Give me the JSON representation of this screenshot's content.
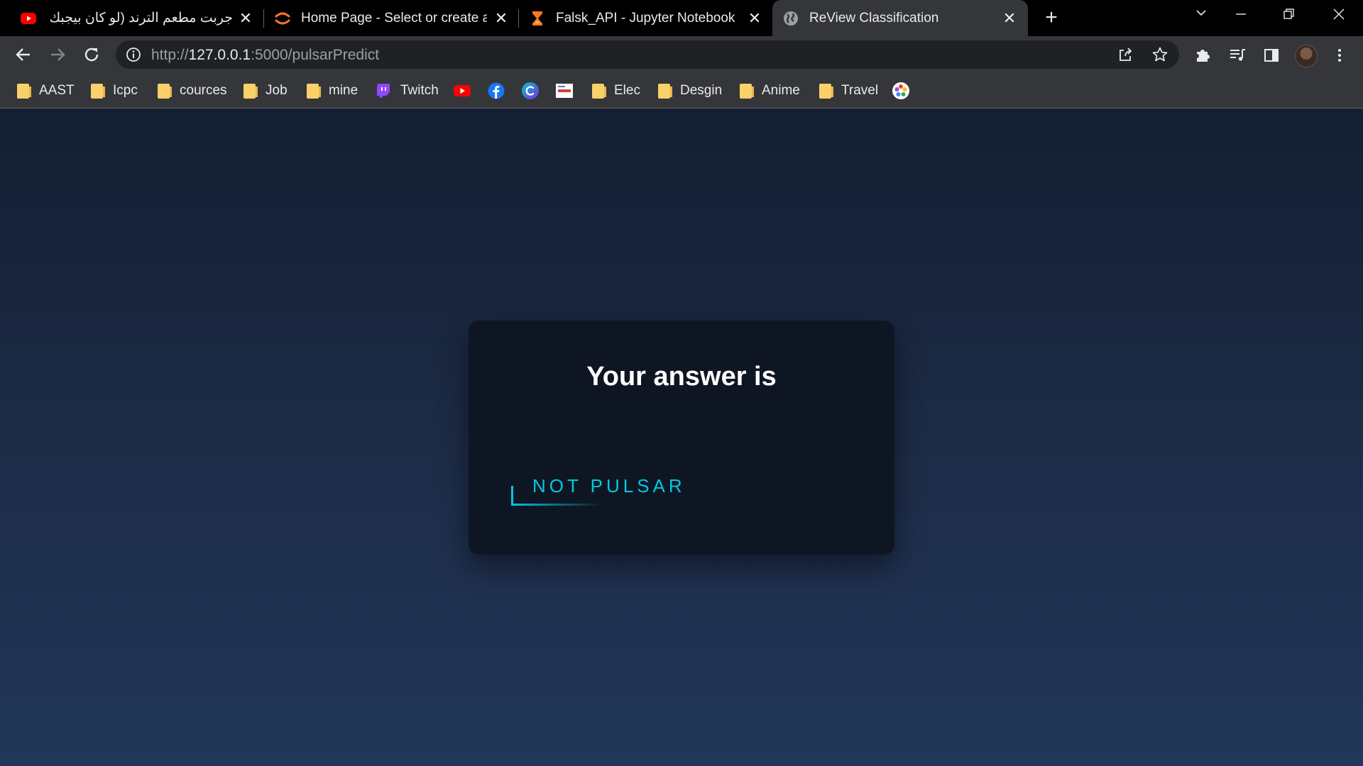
{
  "browser": {
    "tabs": [
      {
        "title": "جربت مطعم الترند (لو كان بيجبك",
        "favicon": "youtube-icon",
        "active": false
      },
      {
        "title": "Home Page - Select or create a n",
        "favicon": "jupyter-icon",
        "active": false
      },
      {
        "title": "Falsk_API - Jupyter Notebook",
        "favicon": "hourglass-icon",
        "active": false
      },
      {
        "title": "ReView Classification",
        "favicon": "globe-icon",
        "active": true
      }
    ],
    "address": {
      "scheme": "http://",
      "host": "127.0.0.1",
      "rest": ":5000/pulsarPredict"
    },
    "bookmarks": [
      {
        "label": "AAST",
        "icon": "folder-icon"
      },
      {
        "label": "Icpc",
        "icon": "folder-icon"
      },
      {
        "label": "cources",
        "icon": "folder-icon"
      },
      {
        "label": "Job",
        "icon": "folder-icon"
      },
      {
        "label": "mine",
        "icon": "folder-icon"
      },
      {
        "label": "Twitch",
        "icon": "twitch-icon"
      },
      {
        "label": "",
        "icon": "youtube-icon"
      },
      {
        "label": "",
        "icon": "facebook-icon"
      },
      {
        "label": "",
        "icon": "canva-icon"
      },
      {
        "label": "",
        "icon": "site-icon"
      },
      {
        "label": "Elec",
        "icon": "folder-icon"
      },
      {
        "label": "Desgin",
        "icon": "folder-icon"
      },
      {
        "label": "Anime",
        "icon": "folder-icon"
      },
      {
        "label": "Travel",
        "icon": "folder-icon"
      },
      {
        "label": "",
        "icon": "chrome-colors-icon"
      }
    ]
  },
  "page": {
    "heading": "Your answer is",
    "result": "NOT PULSAR",
    "accent_color": "#03c8e0"
  }
}
